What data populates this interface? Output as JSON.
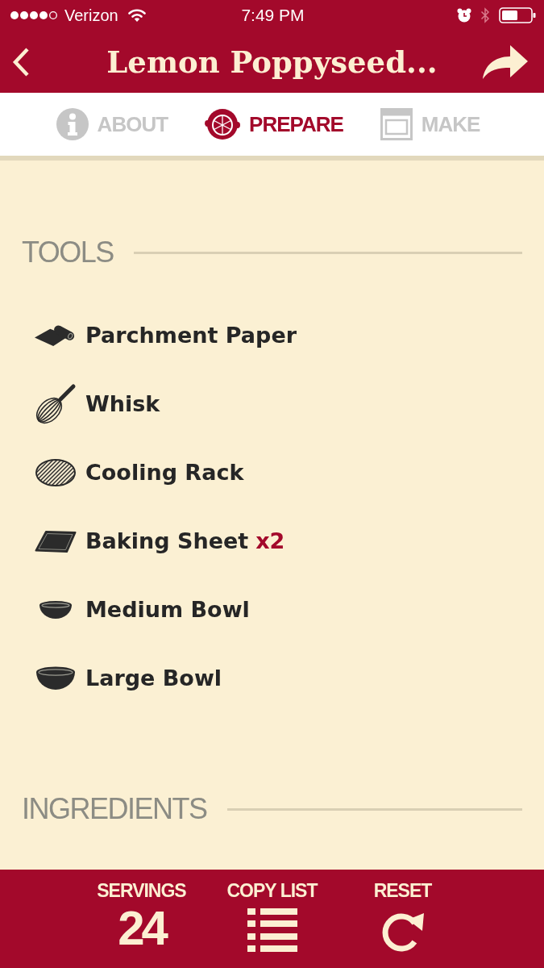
{
  "status_bar": {
    "carrier": "Verizon",
    "time": "7:49 PM"
  },
  "nav": {
    "title": "Lemon Poppyseed..."
  },
  "tabs": [
    {
      "kind": "info",
      "label": "ABOUT",
      "selected": false
    },
    {
      "kind": "lemon",
      "label": "PREPARE",
      "selected": true
    },
    {
      "kind": "oven",
      "label": "MAKE",
      "selected": false
    }
  ],
  "sections": [
    {
      "title": "TOOLS",
      "items": [
        {
          "kind": "parchment",
          "name": "Parchment Paper"
        },
        {
          "kind": "whisk",
          "name": "Whisk"
        },
        {
          "kind": "rack",
          "name": "Cooling Rack"
        },
        {
          "kind": "sheet",
          "name": "Baking Sheet",
          "quantity": "x2"
        },
        {
          "kind": "medium-bowl",
          "name": "Medium Bowl"
        },
        {
          "kind": "large-bowl",
          "name": "Large Bowl"
        }
      ]
    },
    {
      "title": "INGREDIENTS"
    }
  ],
  "bottom_bar": [
    {
      "kind": "value",
      "label": "SERVINGS",
      "value": "24"
    },
    {
      "kind": "list",
      "label": "COPY LIST"
    },
    {
      "kind": "reset",
      "label": "RESET"
    }
  ]
}
